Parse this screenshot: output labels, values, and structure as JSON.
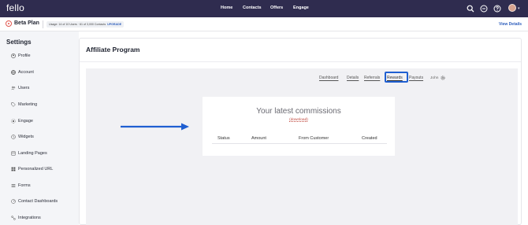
{
  "app": {
    "logo_text": "fello",
    "nav": [
      {
        "label": "Home"
      },
      {
        "label": "Contacts"
      },
      {
        "label": "Offers"
      },
      {
        "label": "Engage"
      }
    ],
    "icons": [
      "search-icon",
      "minus-circle-icon",
      "help-icon",
      "avatar",
      "chevron-down-icon"
    ]
  },
  "plan": {
    "name": "Beta Plan",
    "usage_text": "Usage: 14 of 10 Users · 61 of 3,000 Contacts",
    "upgrade_label": "UPGRADE",
    "view_details_label": "View Details"
  },
  "sidebar": {
    "title": "Settings",
    "items": [
      {
        "label": "Profile",
        "icon": "user-circle-icon"
      },
      {
        "label": "Account",
        "icon": "globe-icon"
      },
      {
        "label": "Users",
        "icon": "users-icon"
      },
      {
        "label": "Marketing",
        "icon": "tag-icon"
      },
      {
        "label": "Engage",
        "icon": "engage-icon"
      },
      {
        "label": "Widgets",
        "icon": "widget-icon"
      },
      {
        "label": "Landing Pages",
        "icon": "page-icon"
      },
      {
        "label": "Personalized URL",
        "icon": "grid-icon"
      },
      {
        "label": "Forms",
        "icon": "list-icon"
      },
      {
        "label": "Contact Dashboards",
        "icon": "dashboard-icon"
      },
      {
        "label": "Integrations",
        "icon": "integrations-icon"
      }
    ]
  },
  "main": {
    "title": "Affiliate Program",
    "tabs": [
      {
        "label": "Dashboard"
      },
      {
        "label": "Details"
      },
      {
        "label": "Referrals"
      },
      {
        "label": "Rewards",
        "active": true
      },
      {
        "label": "Payouts"
      }
    ],
    "user_label": "John",
    "commissions": {
      "title": "Your latest commissions",
      "download_label": "(download)",
      "columns": [
        "Status",
        "Amount",
        "From Customer",
        "Created"
      ]
    }
  },
  "colors": {
    "nav_bg": "#2f2c4f",
    "accent_blue": "#1f5fd1",
    "plan_icon": "#e1574f"
  }
}
